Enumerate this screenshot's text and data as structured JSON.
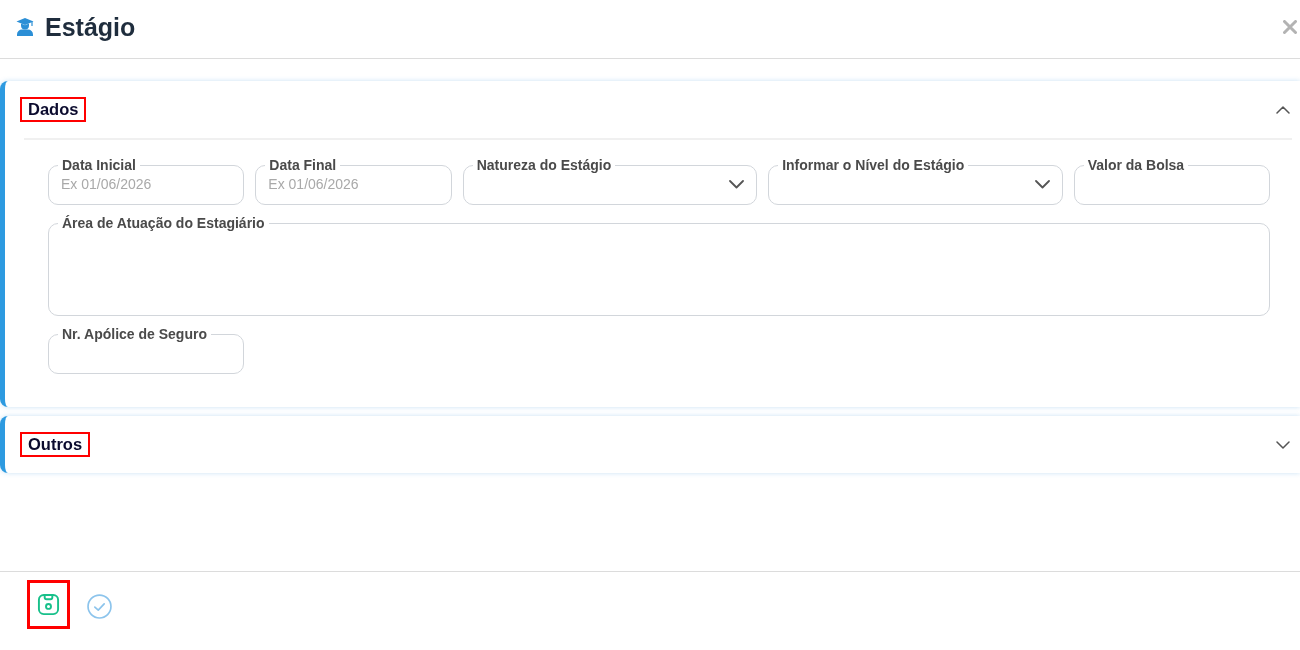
{
  "window": {
    "title": "Estágio"
  },
  "sections": [
    {
      "title": "Dados",
      "expanded": true,
      "highlighted": true,
      "fields": [
        {
          "kind": "date",
          "label": "Data Inicial",
          "placeholder": "Ex 01/06/2026"
        },
        {
          "kind": "date",
          "label": "Data Final",
          "placeholder": "Ex 01/06/2026"
        },
        {
          "kind": "select",
          "label": "Natureza do Estágio"
        },
        {
          "kind": "select",
          "label": "Informar o Nível do Estágio"
        },
        {
          "kind": "text",
          "label": "Valor da Bolsa"
        },
        {
          "kind": "textarea",
          "label": "Área de Atuação do Estagiário"
        },
        {
          "kind": "text",
          "label": "Nr. Apólice de Seguro"
        }
      ]
    },
    {
      "title": "Outros",
      "expanded": false,
      "highlighted": true
    }
  ],
  "footer": {
    "buttons": [
      {
        "kind": "save",
        "highlighted": true
      },
      {
        "kind": "confirm",
        "highlighted": false
      }
    ]
  }
}
